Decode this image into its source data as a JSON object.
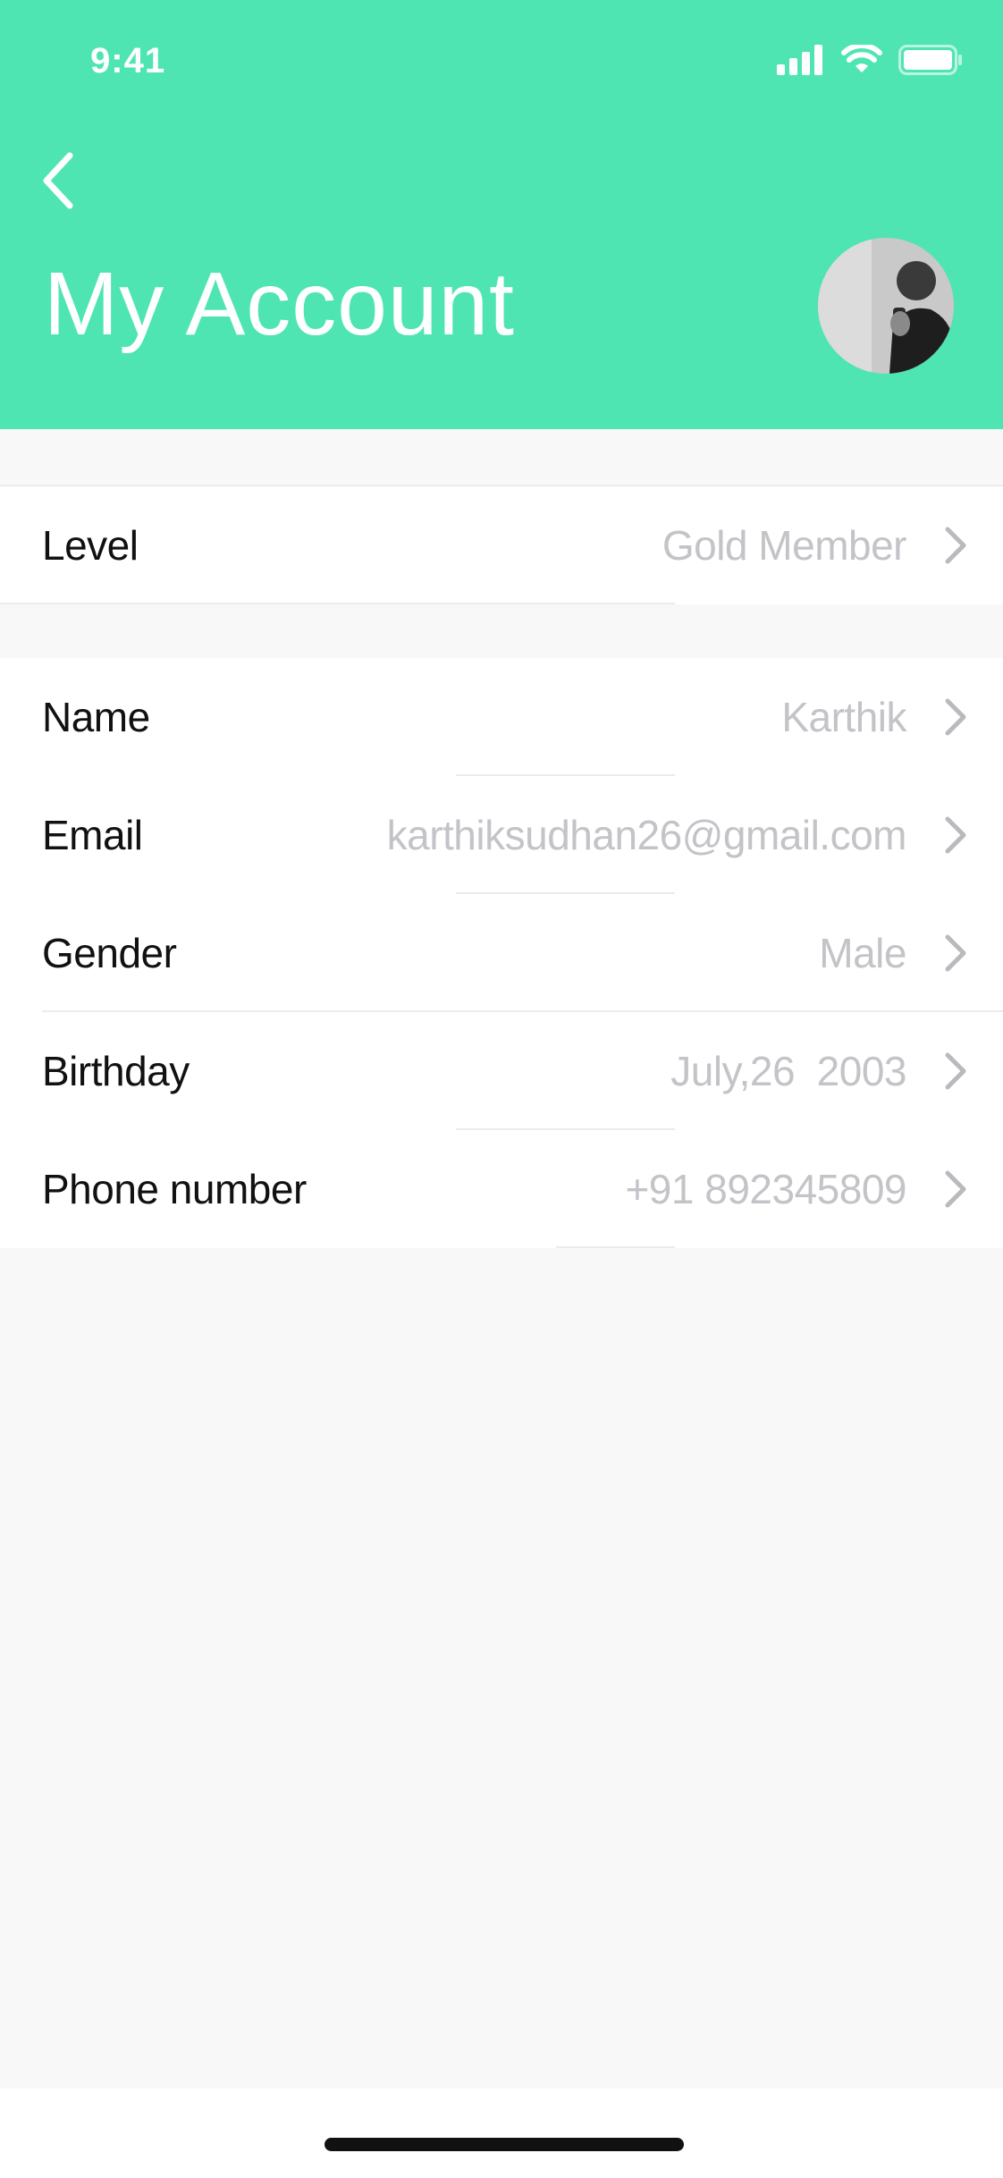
{
  "status_bar": {
    "time": "9:41"
  },
  "header": {
    "title": "My Account",
    "background_color": "#4fe5b2"
  },
  "level_section": {
    "rows": [
      {
        "label": "Level",
        "value": "Gold Member"
      }
    ]
  },
  "profile_section": {
    "rows": [
      {
        "label": "Name",
        "value": "Karthik"
      },
      {
        "label": "Email",
        "value": "karthiksudhan26@gmail.com"
      },
      {
        "label": "Gender",
        "value": "Male"
      },
      {
        "label": "Birthday",
        "value": "July,26  2003"
      },
      {
        "label": "Phone number",
        "value": "+91 892345809"
      }
    ]
  },
  "icons": {
    "back": "chevron-left-icon",
    "row_disclosure": "chevron-right-icon",
    "signal": "cellular-signal-icon",
    "wifi": "wifi-icon",
    "battery": "battery-icon"
  },
  "colors": {
    "accent": "#4fe5b2",
    "label_text": "#111111",
    "value_text": "#c3c3c8",
    "chevron": "#b9b9be",
    "page_background": "#f8f8f8"
  }
}
